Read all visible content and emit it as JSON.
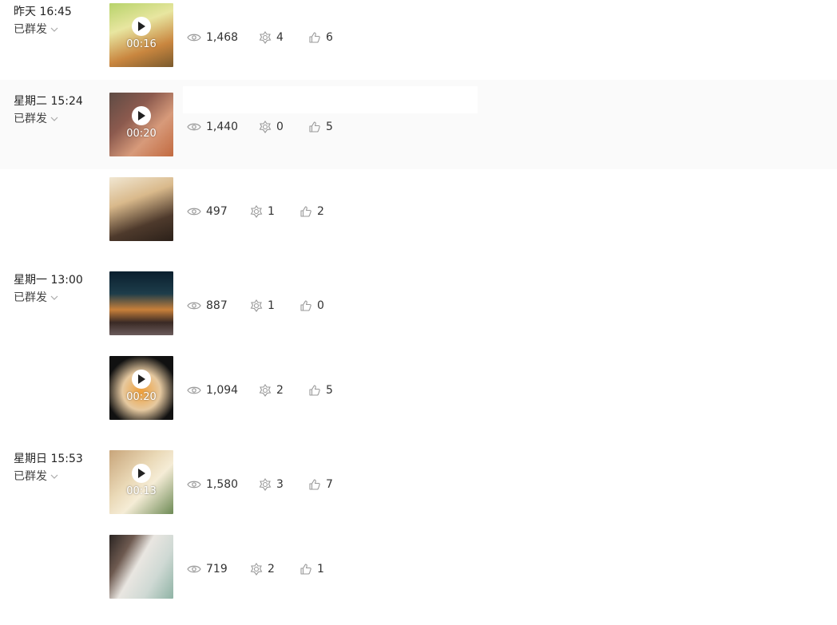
{
  "posts": [
    {
      "time": "昨天 16:45",
      "status": "已群发",
      "duration": "00:16",
      "views": "1,468",
      "shares": "4",
      "likes": "6"
    },
    {
      "time": "星期二 15:24",
      "status": "已群发",
      "duration": "00:20",
      "views": "1,440",
      "shares": "0",
      "likes": "5"
    },
    {
      "time": "",
      "status": "",
      "duration": "",
      "views": "497",
      "shares": "1",
      "likes": "2"
    },
    {
      "time": "星期一 13:00",
      "status": "已群发",
      "duration": "",
      "views": "887",
      "shares": "1",
      "likes": "0"
    },
    {
      "time": "",
      "status": "",
      "duration": "00:20",
      "views": "1,094",
      "shares": "2",
      "likes": "5"
    },
    {
      "time": "星期日 15:53",
      "status": "已群发",
      "duration": "00:13",
      "views": "1,580",
      "shares": "3",
      "likes": "7"
    },
    {
      "time": "",
      "status": "",
      "duration": "",
      "views": "719",
      "shares": "2",
      "likes": "1"
    }
  ],
  "icons": {
    "views": "eye-icon",
    "shares": "share-flower-icon",
    "likes": "thumbs-up-icon",
    "play": "play-icon",
    "expand": "chevron-down-icon"
  }
}
